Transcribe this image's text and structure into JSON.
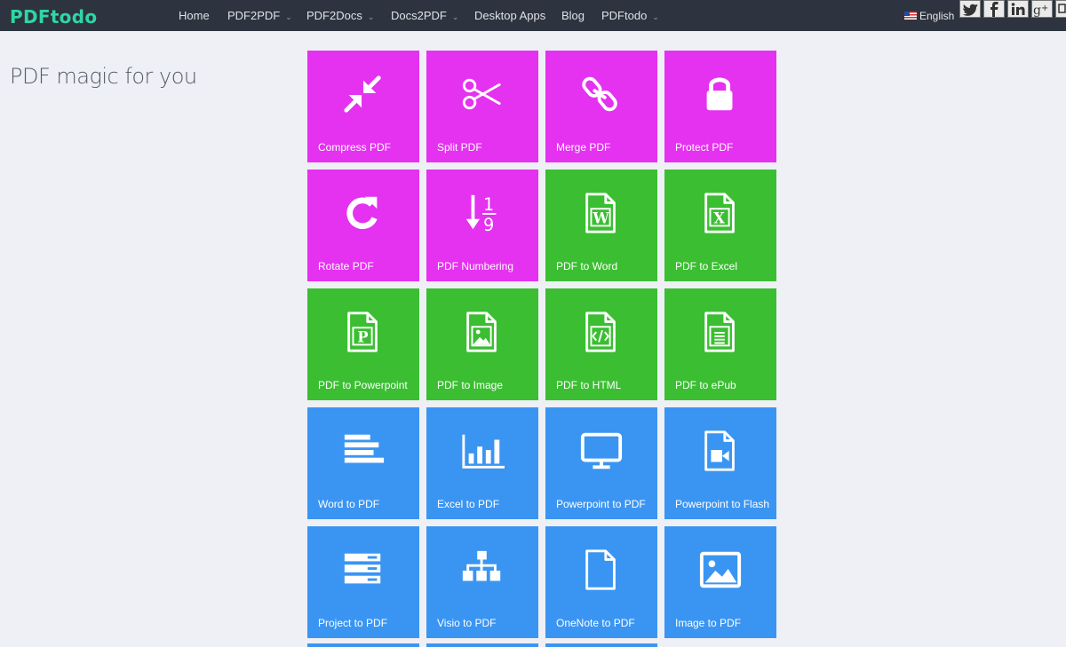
{
  "header": {
    "logo": "PDFtodo",
    "nav": [
      {
        "label": "Home",
        "dropdown": false
      },
      {
        "label": "PDF2PDF",
        "dropdown": true
      },
      {
        "label": "PDF2Docs",
        "dropdown": true
      },
      {
        "label": "Docs2PDF",
        "dropdown": true
      },
      {
        "label": "Desktop Apps",
        "dropdown": false
      },
      {
        "label": "Blog",
        "dropdown": false
      },
      {
        "label": "PDFtodo",
        "dropdown": true
      }
    ],
    "language": "English",
    "social": [
      "twitter-icon",
      "facebook-icon",
      "linkedin-icon",
      "googleplus-icon"
    ]
  },
  "tagline": "PDF magic for you",
  "colors": {
    "magenta": "#e531f0",
    "green": "#3bbe32",
    "blue": "#3a95f2",
    "topbar": "#2d343f",
    "logo": "#2fd6a5"
  },
  "tools": [
    {
      "label": "Compress PDF",
      "icon": "compress-icon",
      "color": "magenta"
    },
    {
      "label": "Split PDF",
      "icon": "scissors-icon",
      "color": "magenta"
    },
    {
      "label": "Merge PDF",
      "icon": "link-icon",
      "color": "magenta"
    },
    {
      "label": "Protect PDF",
      "icon": "lock-icon",
      "color": "magenta"
    },
    {
      "label": "Rotate PDF",
      "icon": "rotate-icon",
      "color": "magenta"
    },
    {
      "label": "PDF Numbering",
      "icon": "numbering-icon",
      "color": "magenta"
    },
    {
      "label": "PDF to Word",
      "icon": "word-file-icon",
      "color": "green"
    },
    {
      "label": "PDF to Excel",
      "icon": "excel-file-icon",
      "color": "green"
    },
    {
      "label": "PDF to Powerpoint",
      "icon": "powerpoint-file-icon",
      "color": "green"
    },
    {
      "label": "PDF to Image",
      "icon": "image-file-icon",
      "color": "green"
    },
    {
      "label": "PDF to HTML",
      "icon": "code-file-icon",
      "color": "green"
    },
    {
      "label": "PDF to ePub",
      "icon": "text-file-icon",
      "color": "green"
    },
    {
      "label": "Word to PDF",
      "icon": "align-left-icon",
      "color": "blue"
    },
    {
      "label": "Excel to PDF",
      "icon": "bar-chart-icon",
      "color": "blue"
    },
    {
      "label": "Powerpoint to PDF",
      "icon": "monitor-icon",
      "color": "blue"
    },
    {
      "label": "Powerpoint to Flash",
      "icon": "video-file-icon",
      "color": "blue"
    },
    {
      "label": "Project to PDF",
      "icon": "server-icon",
      "color": "blue"
    },
    {
      "label": "Visio to PDF",
      "icon": "sitemap-icon",
      "color": "blue"
    },
    {
      "label": "OneNote to PDF",
      "icon": "blank-file-icon",
      "color": "blue"
    },
    {
      "label": "Image to PDF",
      "icon": "picture-icon",
      "color": "blue"
    }
  ]
}
